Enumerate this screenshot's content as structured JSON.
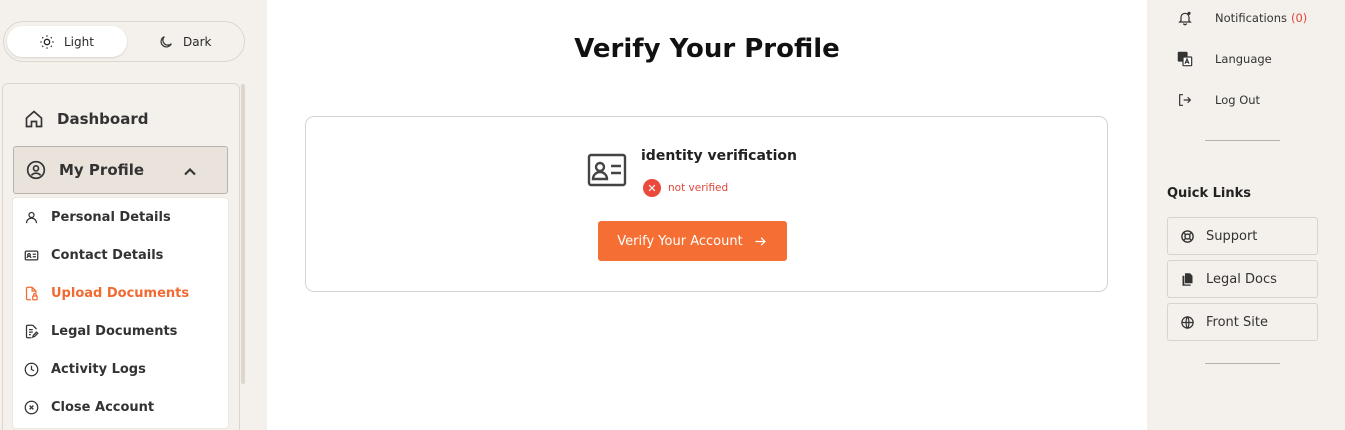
{
  "theme": {
    "light_label": "Light",
    "dark_label": "Dark"
  },
  "nav": {
    "dashboard": "Dashboard",
    "my_profile": "My Profile",
    "sub_items": [
      {
        "label": "Personal Details",
        "icon": "user-icon"
      },
      {
        "label": "Contact Details",
        "icon": "contact-card-icon"
      },
      {
        "label": "Upload Documents",
        "icon": "file-lock-icon",
        "active": true
      },
      {
        "label": "Legal Documents",
        "icon": "document-pen-icon"
      },
      {
        "label": "Activity Logs",
        "icon": "clock-icon"
      },
      {
        "label": "Close Account",
        "icon": "close-circle-icon"
      }
    ]
  },
  "main": {
    "title": "Verify Your Profile",
    "verification": {
      "title": "identity verification",
      "status": "not verified",
      "button": "Verify Your Account"
    }
  },
  "right": {
    "notifications": "Notifications",
    "notifications_count": "(0)",
    "language": "Language",
    "logout": "Log Out",
    "quick_links_title": "Quick Links",
    "quick_links": [
      "Support",
      "Legal Docs",
      "Front Site"
    ]
  },
  "colors": {
    "accent": "#f56f34",
    "error": "#ea4a3c",
    "sidebar_bg": "#f4f0eb"
  }
}
